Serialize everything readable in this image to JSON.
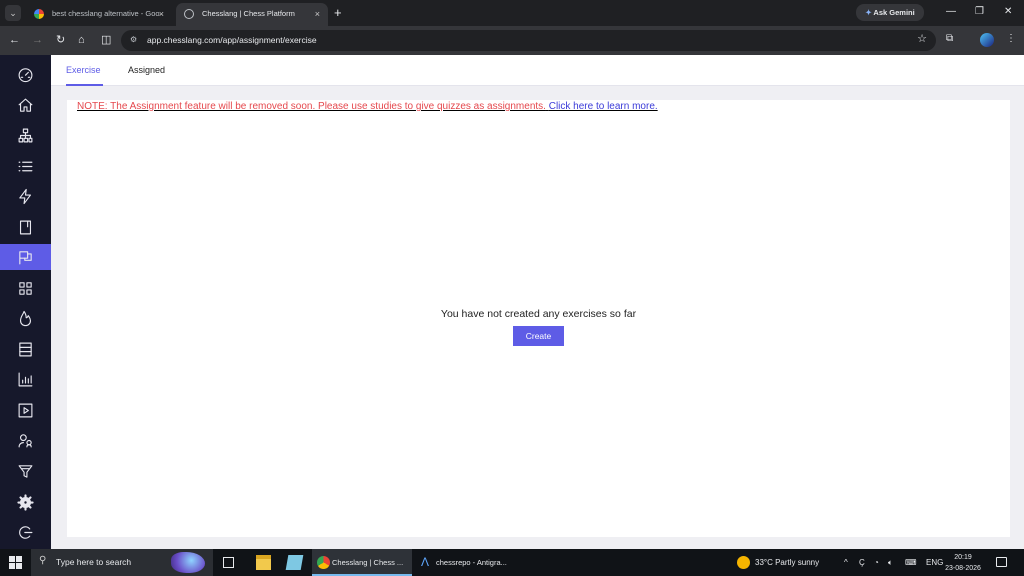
{
  "browser": {
    "tabs": [
      {
        "title": "best chesslang alternative - Goo"
      },
      {
        "title": "Chesslang | Chess Platform"
      }
    ],
    "new_tab": "+",
    "close_glyph": "×",
    "ask_gemini": "Ask Gemini",
    "url": "app.chesslang.com/app/assignment/exercise"
  },
  "sidebar": {
    "items": [
      {
        "icon": "speedometer-icon"
      },
      {
        "icon": "home-icon"
      },
      {
        "icon": "hierarchy-icon"
      },
      {
        "icon": "list-icon"
      },
      {
        "icon": "lightning-icon"
      },
      {
        "icon": "book-icon"
      },
      {
        "icon": "assignment-icon",
        "active": true
      },
      {
        "icon": "grid-icon"
      },
      {
        "icon": "flame-icon"
      },
      {
        "icon": "archive-icon"
      },
      {
        "icon": "bar-chart-icon"
      },
      {
        "icon": "play-icon"
      },
      {
        "icon": "users-icon"
      },
      {
        "icon": "filter-icon"
      },
      {
        "icon": "settings-icon"
      },
      {
        "icon": "logout-icon"
      }
    ],
    "active_color": "#5e5ce6"
  },
  "main": {
    "tabs": [
      {
        "label": "Exercise",
        "active": true
      },
      {
        "label": "Assigned",
        "active": false
      }
    ],
    "note_text": "NOTE: The Assignment feature will be removed soon. Please use studies to give quizzes as assignments.",
    "note_link": "Click here to learn more.",
    "empty_message": "You have not created any exercises so far",
    "create_label": "Create"
  },
  "taskbar": {
    "search_placeholder": "Type here to search",
    "apps": [
      {
        "label": "Chesslang | Chess ...",
        "active": true
      },
      {
        "label": "chessrepo - Antigra...",
        "active": false
      }
    ],
    "weather": "33°C  Partly sunny",
    "language": "ENG",
    "time": "20:19",
    "date": "23-08-2026"
  },
  "colors": {
    "accent": "#5e5ce6",
    "note_red": "#e5484d",
    "link_blue": "#3b3bd8"
  }
}
